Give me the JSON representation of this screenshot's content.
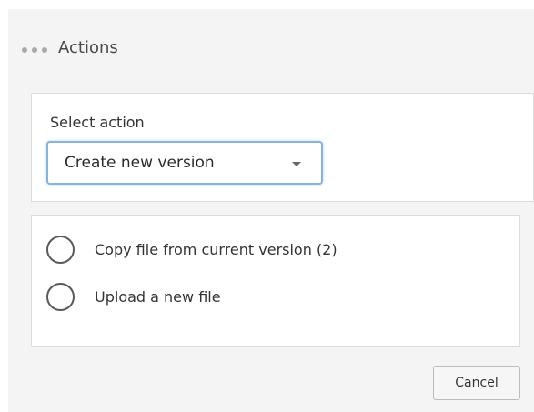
{
  "header": {
    "title": "Actions",
    "icon": "more-dots-icon"
  },
  "select_section": {
    "label": "Select action",
    "selected_value": "Create new version"
  },
  "options": [
    {
      "label": "Copy file from current version (2)",
      "checked": false
    },
    {
      "label": "Upload a new file",
      "checked": false
    }
  ],
  "footer": {
    "cancel_label": "Cancel"
  }
}
